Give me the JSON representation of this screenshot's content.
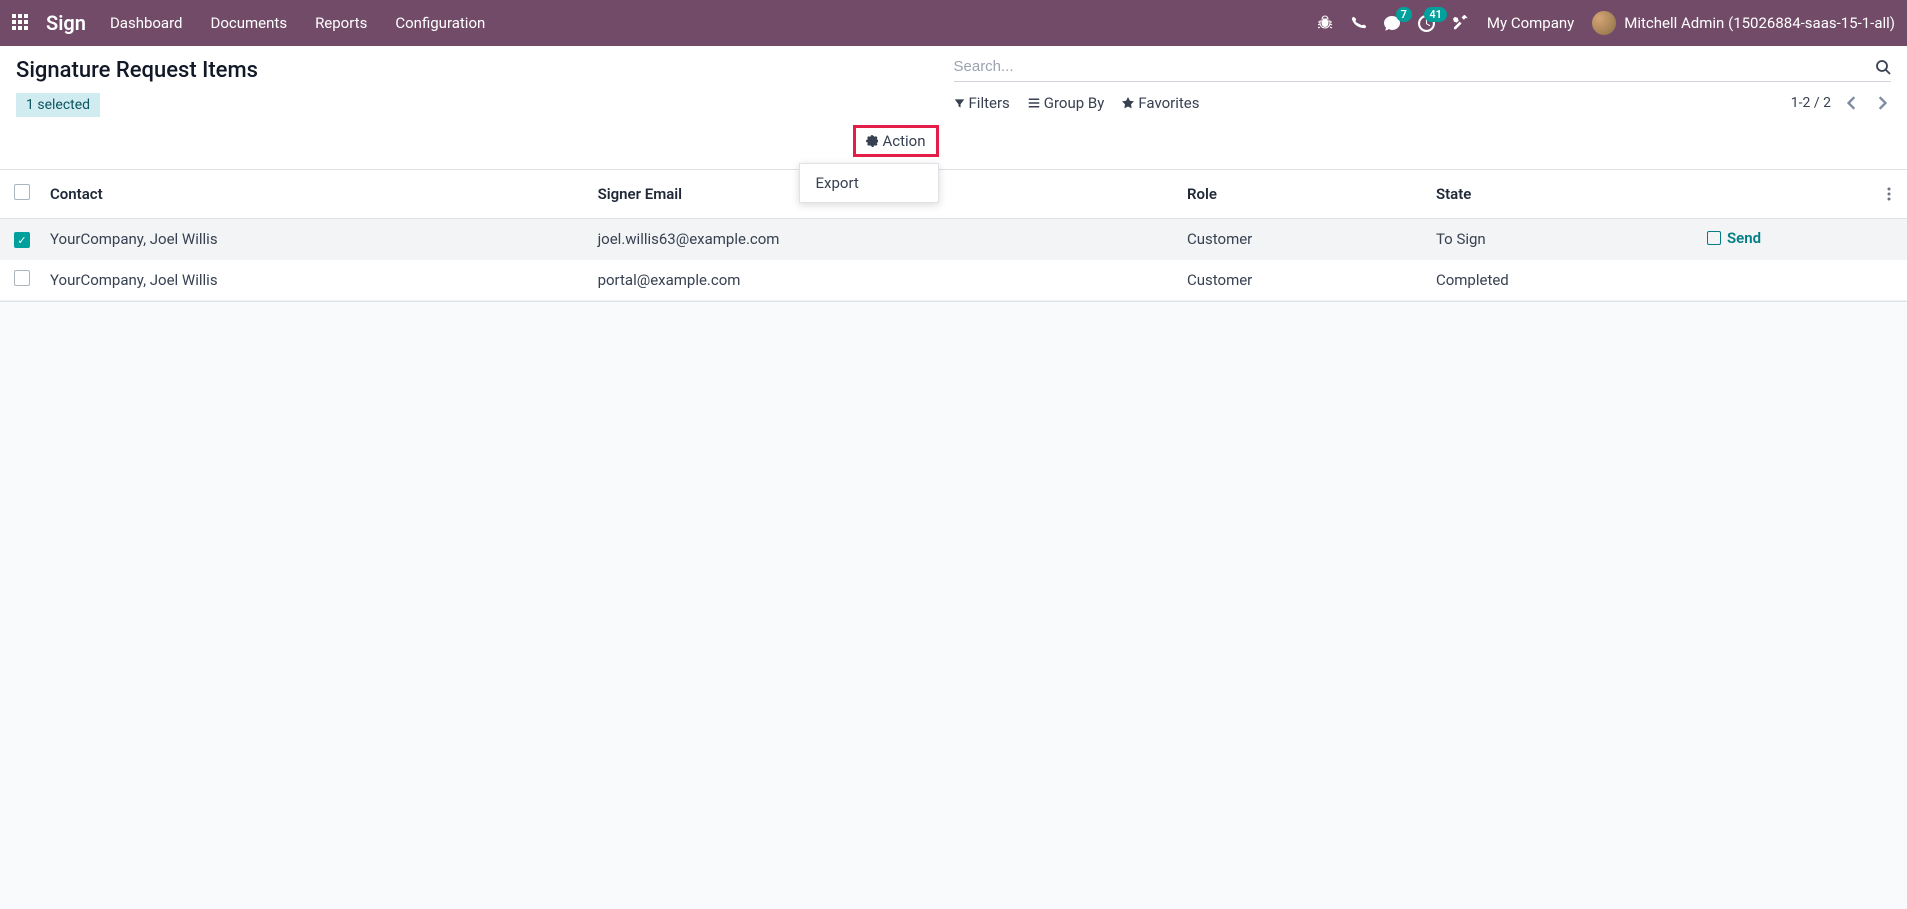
{
  "topnav": {
    "brand": "Sign",
    "menu": [
      "Dashboard",
      "Documents",
      "Reports",
      "Configuration"
    ],
    "messaging_badge": "7",
    "activity_badge": "41",
    "company": "My Company",
    "user": "Mitchell Admin (15026884-saas-15-1-all)"
  },
  "page": {
    "title": "Signature Request Items",
    "selected_label": "1 selected",
    "search_placeholder": "Search...",
    "action_label": "Action",
    "action_menu": {
      "export": "Export"
    },
    "filters_label": "Filters",
    "groupby_label": "Group By",
    "favorites_label": "Favorites",
    "pager": "1-2 / 2"
  },
  "table": {
    "headers": {
      "contact": "Contact",
      "signer_email": "Signer Email",
      "role": "Role",
      "state": "State"
    },
    "rows": [
      {
        "checked": true,
        "contact": "YourCompany, Joel Willis",
        "email": "joel.willis63@example.com",
        "role": "Customer",
        "state": "To Sign",
        "send_label": "Send"
      },
      {
        "checked": false,
        "contact": "YourCompany, Joel Willis",
        "email": "portal@example.com",
        "role": "Customer",
        "state": "Completed",
        "send_label": ""
      }
    ]
  }
}
